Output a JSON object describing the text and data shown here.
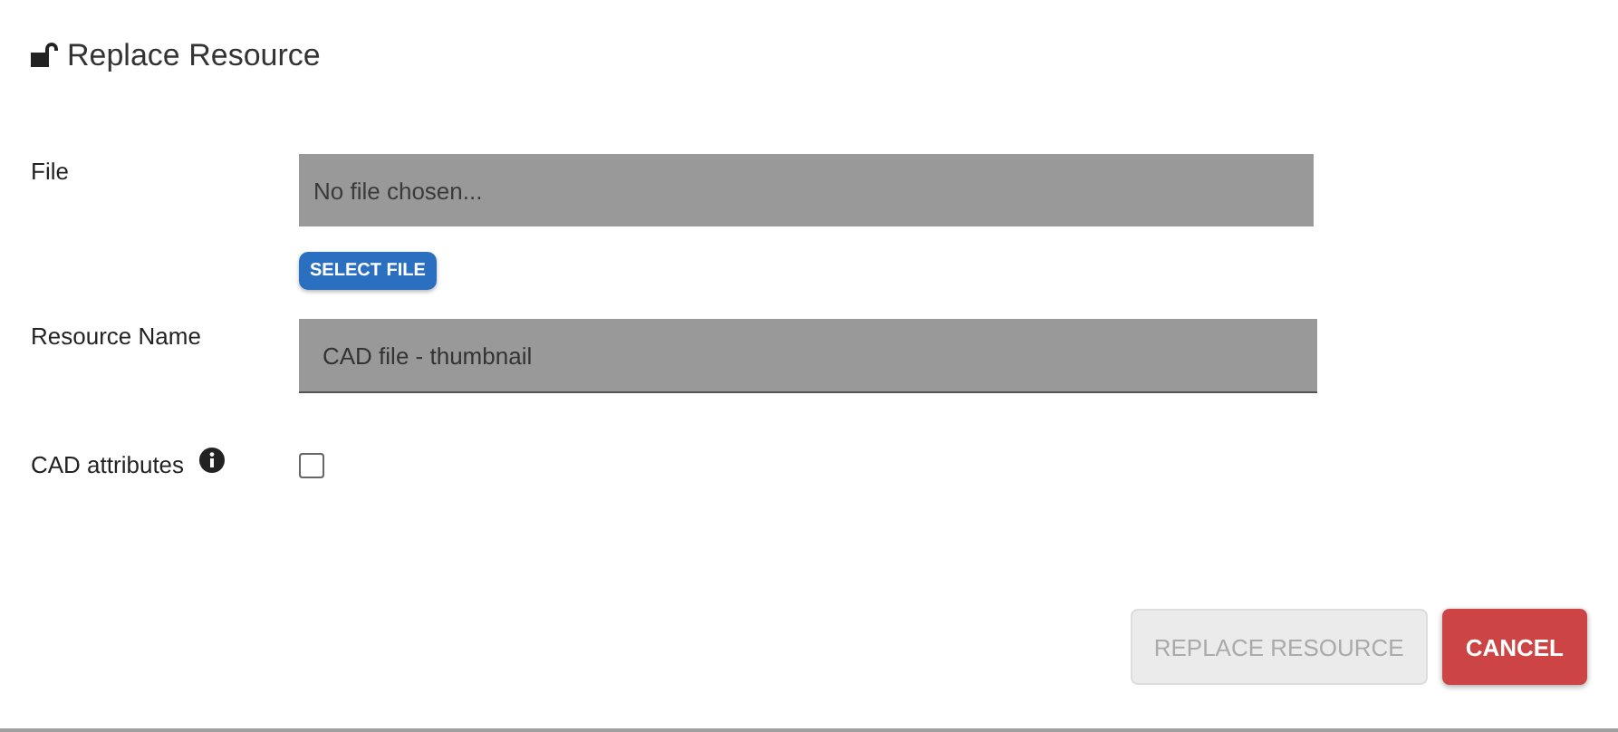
{
  "dialog": {
    "title": "Replace Resource",
    "locked": false
  },
  "file": {
    "label": "File",
    "placeholder": "No file chosen...",
    "button": "SELECT FILE"
  },
  "resource_name": {
    "label": "Resource Name",
    "value": "CAD file - thumbnail"
  },
  "cad_attributes": {
    "label": "CAD attributes",
    "checked": false
  },
  "buttons": [
    {
      "label": "REPLACE RESOURCE",
      "kind": "primary",
      "disabled": true
    },
    {
      "label": "CANCEL",
      "kind": "danger",
      "disabled": false
    }
  ]
}
